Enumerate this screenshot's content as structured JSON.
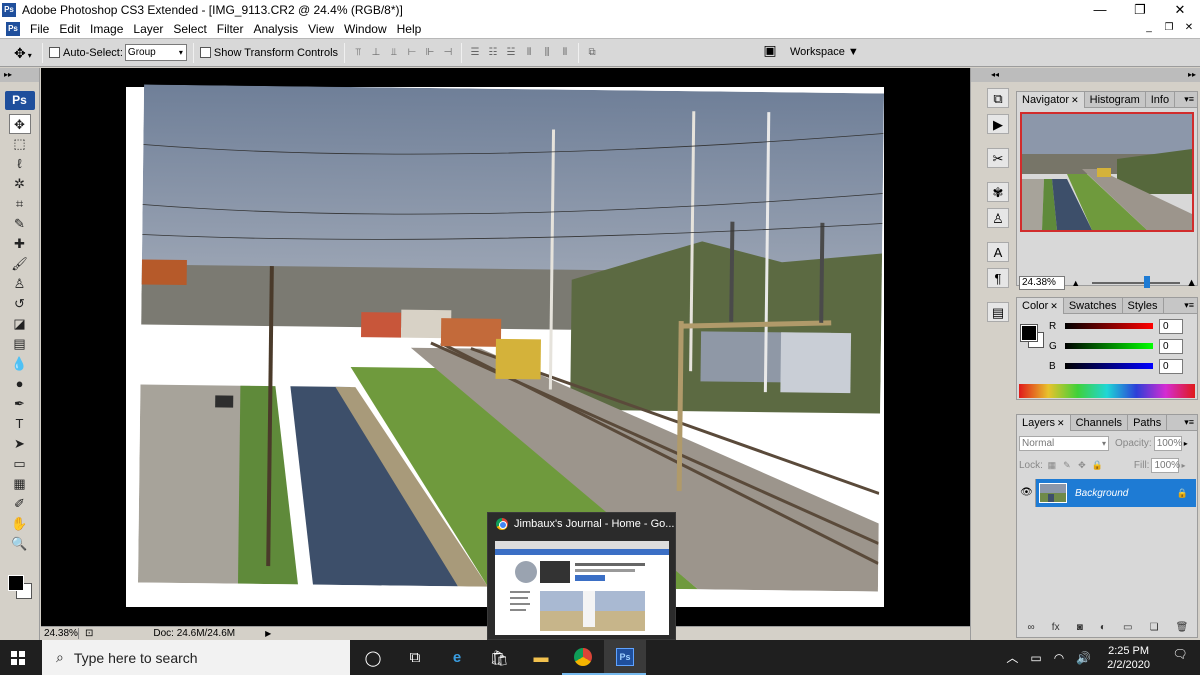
{
  "window": {
    "app_badge": "Ps",
    "title": "Adobe Photoshop CS3 Extended - [IMG_9113.CR2 @ 24.4% (RGB/8*)]",
    "controls": [
      "—",
      "❐",
      "✕"
    ]
  },
  "menubar": {
    "badge": "Ps",
    "items": [
      "File",
      "Edit",
      "Image",
      "Layer",
      "Select",
      "Filter",
      "Analysis",
      "View",
      "Window",
      "Help"
    ],
    "doc_controls": [
      "_",
      "❐",
      "✕"
    ]
  },
  "options": {
    "auto_select_label": "Auto-Select:",
    "auto_select_value": "Group",
    "show_transform_label": "Show Transform Controls",
    "workspace_label": "Workspace ▼"
  },
  "toolbox": {
    "logo": "Ps",
    "tools": [
      {
        "name": "move-tool",
        "glyph": "✥",
        "selected": true
      },
      {
        "name": "marquee-tool",
        "glyph": "⬚"
      },
      {
        "name": "lasso-tool",
        "glyph": "ℓ"
      },
      {
        "name": "magic-wand-tool",
        "glyph": "✲"
      },
      {
        "name": "crop-tool",
        "glyph": "⌗"
      },
      {
        "name": "slice-tool",
        "glyph": "✎"
      },
      {
        "name": "healing-brush-tool",
        "glyph": "✚"
      },
      {
        "name": "brush-tool",
        "glyph": "🖌"
      },
      {
        "name": "clone-stamp-tool",
        "glyph": "♙"
      },
      {
        "name": "history-brush-tool",
        "glyph": "↺"
      },
      {
        "name": "eraser-tool",
        "glyph": "◪"
      },
      {
        "name": "gradient-tool",
        "glyph": "▤"
      },
      {
        "name": "blur-tool",
        "glyph": "💧"
      },
      {
        "name": "dodge-tool",
        "glyph": "●"
      },
      {
        "name": "pen-tool",
        "glyph": "✒"
      },
      {
        "name": "type-tool",
        "glyph": "T"
      },
      {
        "name": "path-selection-tool",
        "glyph": "➤"
      },
      {
        "name": "shape-tool",
        "glyph": "▭"
      },
      {
        "name": "notes-tool",
        "glyph": "▦"
      },
      {
        "name": "eyedropper-tool",
        "glyph": "✐"
      },
      {
        "name": "hand-tool",
        "glyph": "✋"
      },
      {
        "name": "zoom-tool",
        "glyph": "🔍"
      }
    ]
  },
  "statusbar": {
    "zoom": "24.38%",
    "doc": "Doc: 24.6M/24.6M",
    "play": "▶"
  },
  "panels": {
    "navigator": {
      "tabs": [
        "Navigator",
        "Histogram",
        "Info"
      ],
      "zoom": "24.38%",
      "zoom_fraction": 0.55
    },
    "color": {
      "tabs": [
        "Color",
        "Swatches",
        "Styles"
      ],
      "r_label": "R",
      "r_value": "0",
      "g_label": "G",
      "g_value": "0",
      "b_label": "B",
      "b_value": "0"
    },
    "layers": {
      "tabs": [
        "Layers",
        "Channels",
        "Paths"
      ],
      "blend_mode": "Normal",
      "opacity_label": "Opacity:",
      "opacity_value": "100%",
      "lock_label": "Lock:",
      "fill_label": "Fill:",
      "fill_value": "100%",
      "layer_name": "Background"
    }
  },
  "preview_popup": {
    "title": "Jimbaux's Journal - Home - Go..."
  },
  "taskbar": {
    "search_placeholder": "Type here to search",
    "ps_badge": "Ps",
    "time": "2:25 PM",
    "date": "2/2/2020"
  },
  "colors": {
    "accent_selection": "#1e7bd4",
    "ps_blue": "#1f4f9c",
    "navigator_frame": "#d12c2c"
  }
}
